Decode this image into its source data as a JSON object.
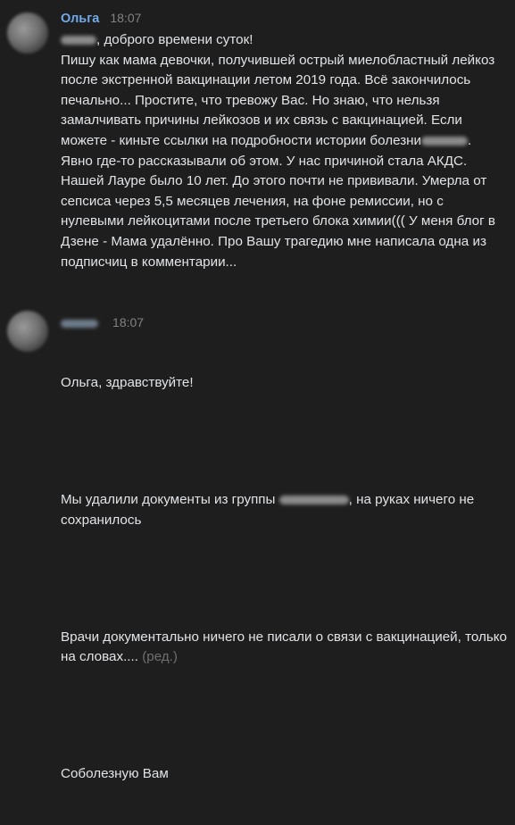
{
  "messages": [
    {
      "author": "Ольга",
      "time": "18:07",
      "text_after_blur": ", доброго времени суток!\nПишу как мама девочки, получившей острый миелобластный лейкоз после экстренной вакцинации летом 2019 года. Всё закончилось печально... Простите, что тревожу Вас. Но знаю, что нельзя замалчивать причины лейкозов и их связь с вакцинацией. Если можете - киньте ссылки на подробности истории болезни",
      "text_end": ". Явно где-то рассказывали об этом. У нас причиной стала АКДС. Нашей Лауре было 10 лет. До этого почти не прививали. Умерла от сепсиса через 5,5 месяцев лечения, на фоне ремиссии, но с нулевыми лейкоцитами после третьего блока химии((( У меня блог в Дзене - Мама удалённо. Про Вашу трагедию мне написала одна из подписчиц в комментарии..."
    },
    {
      "time": "18:07",
      "greeting": "Ольга, здравствуйте!",
      "p1_before": "Мы удалили документы из группы ",
      "p1_after": ", на руках ничего не сохранилось",
      "p2": "Врачи документально ничего не писали о связи с вакцинацией, только на словах....",
      "edited": "(ред.)",
      "p3": "Соболезную Вам"
    }
  ]
}
